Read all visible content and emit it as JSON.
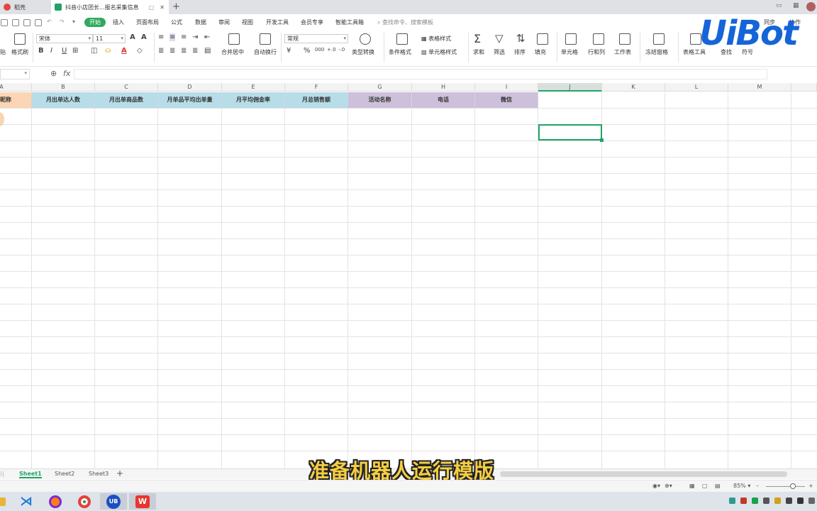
{
  "tabs": [
    {
      "label": "稻壳"
    },
    {
      "label": "抖音小店团长...报名采集信息"
    }
  ],
  "menu": [
    "开始",
    "插入",
    "页面布局",
    "公式",
    "数据",
    "审阅",
    "视图",
    "开发工具",
    "会员专享",
    "智能工具箱"
  ],
  "search_placeholder": "查找命令、搜索模板",
  "top_right": {
    "sync": "同步",
    "collab": "协作"
  },
  "ribbon": {
    "format_painter": "格式刷",
    "font_name": "宋体",
    "font_size": "11",
    "number_format": "常规",
    "merge_center": "合并居中",
    "wrap_text": "自动换行",
    "type_convert": "类型转换",
    "cond_format": "条件格式",
    "table_style": "表格样式",
    "cell_style": "单元格样式",
    "sum": "求和",
    "filter": "筛选",
    "sort": "排序",
    "fill": "填充",
    "cell": "单元格",
    "row_col": "行和列",
    "worksheet": "工作表",
    "freeze": "冻结窗格",
    "table_tools": "表格工具",
    "find": "查找",
    "symbol": "符号"
  },
  "logo_text": "UiBot",
  "columns": [
    "A",
    "B",
    "C",
    "D",
    "E",
    "F",
    "G",
    "H",
    "I",
    "J",
    "K",
    "L",
    "M"
  ],
  "header_row": [
    "昵称",
    "月出单达人数",
    "月出单商品数",
    "月单品平均出单量",
    "月平均佣金率",
    "月总销售额",
    "活动名称",
    "电话",
    "微信"
  ],
  "sheets": [
    "Sheet1",
    "Sheet2",
    "Sheet3"
  ],
  "zoom": "85%",
  "subtitle": "准备机器人运行模版",
  "colors": {
    "accent": "#21a366",
    "header_orange": "#fbd5b5",
    "header_blue": "#b7dde8",
    "header_purple": "#ccc0da",
    "logo_blue": "#1565d8"
  }
}
